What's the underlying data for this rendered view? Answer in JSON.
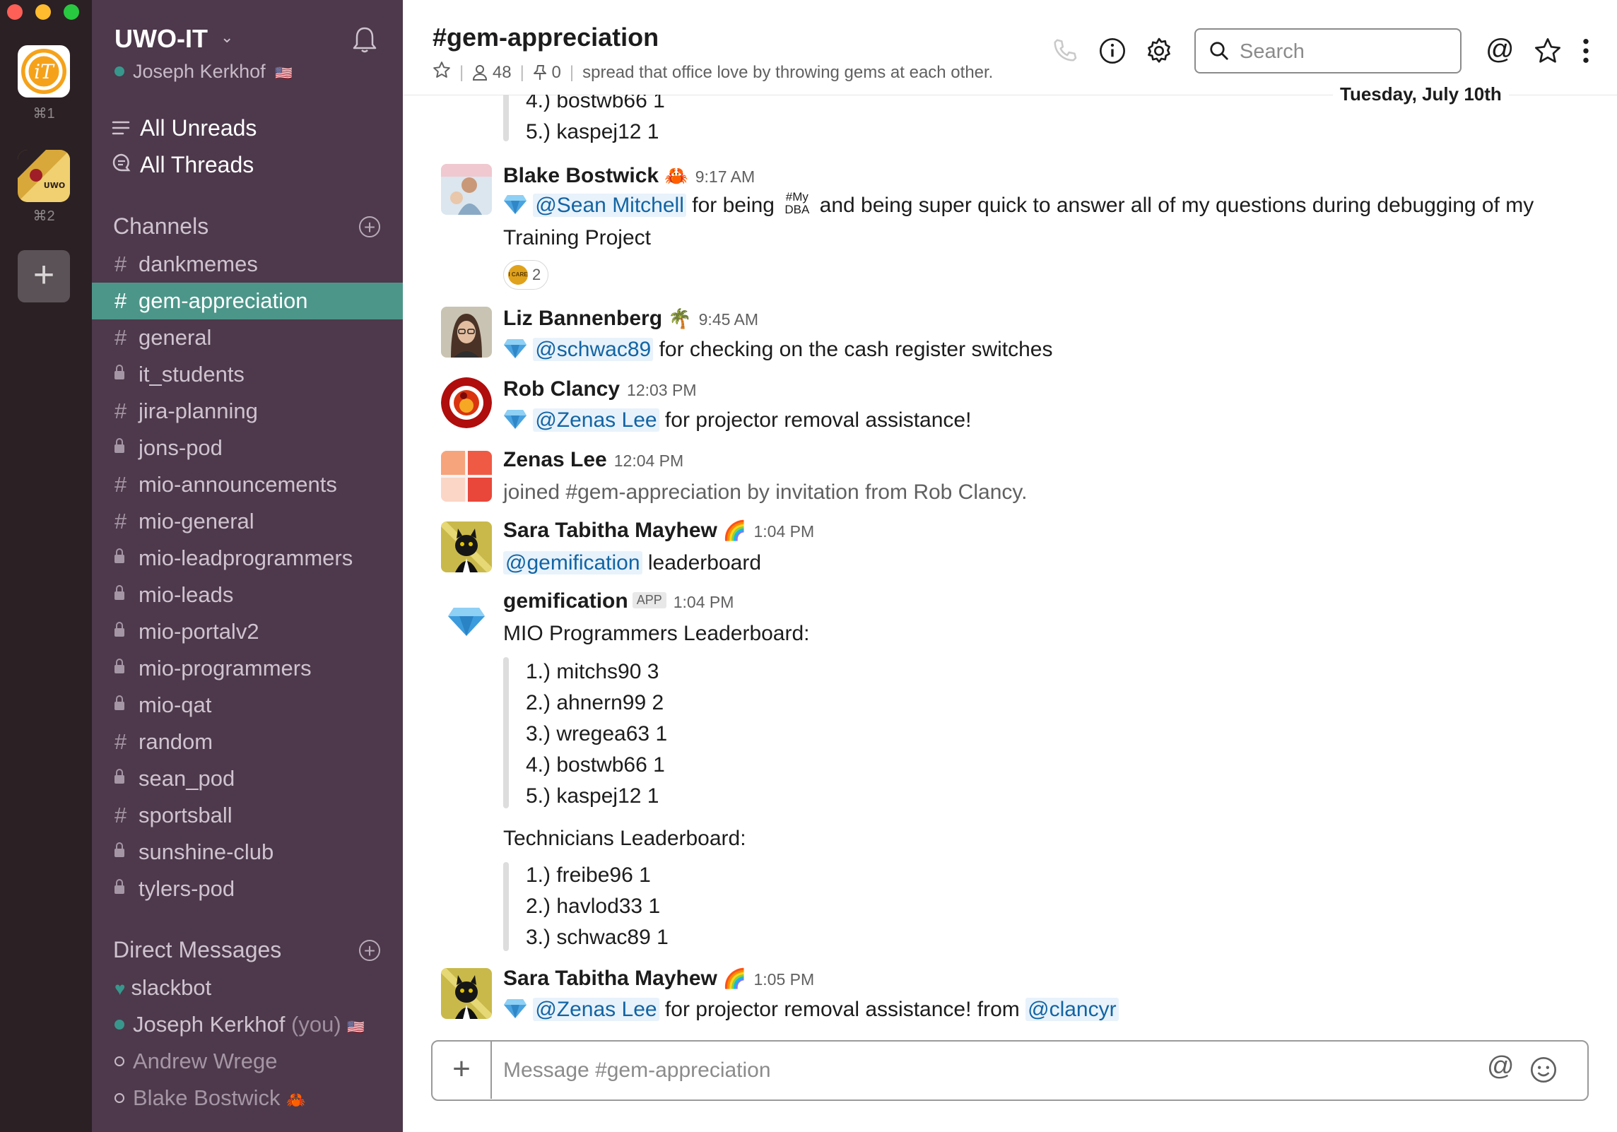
{
  "workspaces": [
    {
      "shortcut": "⌘1"
    },
    {
      "shortcut": "⌘2"
    }
  ],
  "team": {
    "name": "UWO-IT",
    "user": "Joseph Kerkhof",
    "user_flag": "🇺🇸"
  },
  "nav": {
    "all_unreads": "All Unreads",
    "all_threads": "All Threads"
  },
  "channels_header": "Channels",
  "channels": [
    {
      "name": "dankmemes",
      "private": false
    },
    {
      "name": "gem-appreciation",
      "private": false,
      "active": true
    },
    {
      "name": "general",
      "private": false
    },
    {
      "name": "it_students",
      "private": true
    },
    {
      "name": "jira-planning",
      "private": false
    },
    {
      "name": "jons-pod",
      "private": true
    },
    {
      "name": "mio-announcements",
      "private": false
    },
    {
      "name": "mio-general",
      "private": false
    },
    {
      "name": "mio-leadprogrammers",
      "private": true
    },
    {
      "name": "mio-leads",
      "private": true
    },
    {
      "name": "mio-portalv2",
      "private": true
    },
    {
      "name": "mio-programmers",
      "private": true
    },
    {
      "name": "mio-qat",
      "private": true
    },
    {
      "name": "random",
      "private": false
    },
    {
      "name": "sean_pod",
      "private": true
    },
    {
      "name": "sportsball",
      "private": false
    },
    {
      "name": "sunshine-club",
      "private": true
    },
    {
      "name": "tylers-pod",
      "private": true
    }
  ],
  "dm_header": "Direct Messages",
  "dms": [
    {
      "name": "slackbot"
    },
    {
      "name": "Joseph Kerkhof",
      "suffix": "(you)",
      "flag": "🇺🇸"
    },
    {
      "name": "Andrew Wrege"
    },
    {
      "name": "Blake Bostwick",
      "flag": "🦀"
    }
  ],
  "header": {
    "title": "#gem-appreciation",
    "members": "48",
    "pins": "0",
    "topic": "spread that office love by throwing gems at each other.",
    "search_placeholder": "Search",
    "date_divider": "Tuesday, July 10th"
  },
  "top_list": [
    "4.) bostwb66 1",
    "5.) kaspej12 1"
  ],
  "messages": {
    "m1": {
      "author": "Blake Bostwick",
      "status": "🦀",
      "time": "9:17 AM",
      "mention": "@Sean Mitchell",
      "text_a": "for being",
      "dba_top": "#My",
      "dba_bottom": "DBA",
      "text_b": "and being super quick to answer all of my questions during debugging of my",
      "text_c": "Training Project",
      "reaction_label": "I CARE",
      "reaction_count": "2"
    },
    "m2": {
      "author": "Liz Bannenberg",
      "status": "🌴",
      "time": "9:45 AM",
      "mention": "@schwac89",
      "text": "for checking on the cash register switches"
    },
    "m3": {
      "author": "Rob Clancy",
      "time": "12:03 PM",
      "mention": "@Zenas Lee",
      "text": "for projector removal assistance!"
    },
    "m4": {
      "author": "Zenas Lee",
      "time": "12:04 PM",
      "text": "joined #gem-appreciation by invitation from Rob Clancy."
    },
    "m5": {
      "author": "Sara Tabitha Mayhew",
      "status": "🌈",
      "time": "1:04 PM",
      "mention": "@gemification",
      "text": "leaderboard"
    },
    "m6": {
      "author": "gemification",
      "badge": "APP",
      "time": "1:04 PM",
      "programmers_title": "MIO Programmers Leaderboard:",
      "programmers": [
        "1.) mitchs90 3",
        "2.) ahnern99 2",
        "3.) wregea63 1",
        "4.) bostwb66 1",
        "5.) kaspej12 1"
      ],
      "technicians_title": "Technicians Leaderboard:",
      "technicians": [
        "1.) freibe96 1",
        "2.) havlod33 1",
        "3.) schwac89 1"
      ]
    },
    "m7": {
      "author": "Sara Tabitha Mayhew",
      "status": "🌈",
      "time": "1:05 PM",
      "mention": "@Zenas Lee",
      "text": "for  projector removal assistance! from",
      "mention2": "@clancyr"
    }
  },
  "composer": {
    "placeholder": "Message #gem-appreciation"
  },
  "colors": {
    "sidebar": "#4d394b",
    "active_channel": "#4c9689",
    "mention": "#1264a3"
  }
}
